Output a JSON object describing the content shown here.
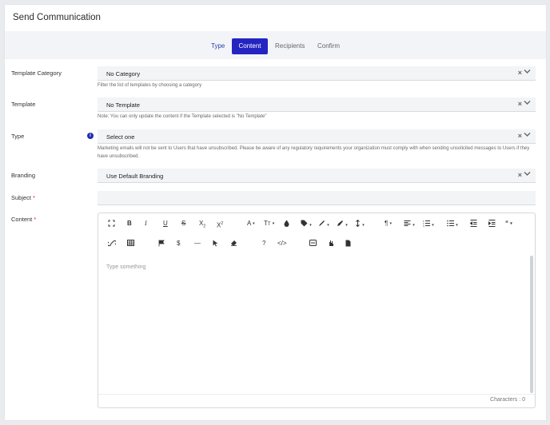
{
  "title": "Send Communication",
  "steps": [
    "Type",
    "Content",
    "Recipients",
    "Confirm"
  ],
  "active_step": "Content",
  "fields": {
    "template_category": {
      "label": "Template Category",
      "value": "No Category",
      "help": "Filter the list of templates by choosing a category"
    },
    "template": {
      "label": "Template",
      "value": "No Template",
      "help": "Note: You can only update the content if the Template selected is \"No Template\""
    },
    "type": {
      "label": "Type",
      "value": "Select one",
      "help": "Marketing emails will not be sent to Users that have unsubscribed. Please be aware of any regulatory requirements your organization must comply with when sending unsolicited messages to Users if they have unsubscribed."
    },
    "branding": {
      "label": "Branding",
      "value": "Use Default Branding"
    },
    "subject": {
      "label": "Subject",
      "value": ""
    },
    "content": {
      "label": "Content",
      "placeholder": "Type something",
      "char_count": "Characters : 0"
    }
  },
  "required_mark": "*",
  "clear_symbol": "×",
  "toolbar": {
    "row1": [
      "fullscreen-icon",
      "bold-icon",
      "italic-icon",
      "underline-icon",
      "strikethrough-icon",
      "subscript-icon",
      "superscript-icon",
      "font-family-icon",
      "font-size-icon",
      "color-icon",
      "tag-icon",
      "highlight-icon",
      "pen-icon",
      "line-height-icon",
      "paragraph-icon",
      "align-icon",
      "ordered-list-icon",
      "unordered-list-icon",
      "outdent-icon",
      "indent-icon",
      "quote-icon"
    ],
    "row2": [
      "link-icon",
      "table-icon",
      "flag-icon",
      "dollar-icon",
      "horizontal-rule-icon",
      "cursor-icon",
      "eraser-icon",
      "help-icon",
      "code-view-icon",
      "merge-field-icon",
      "emoji-icon",
      "document-icon"
    ]
  },
  "colors": {
    "accent": "#2424c2",
    "link": "#2a3fa8",
    "required": "#d9252f",
    "info": "#1f2eb0"
  }
}
